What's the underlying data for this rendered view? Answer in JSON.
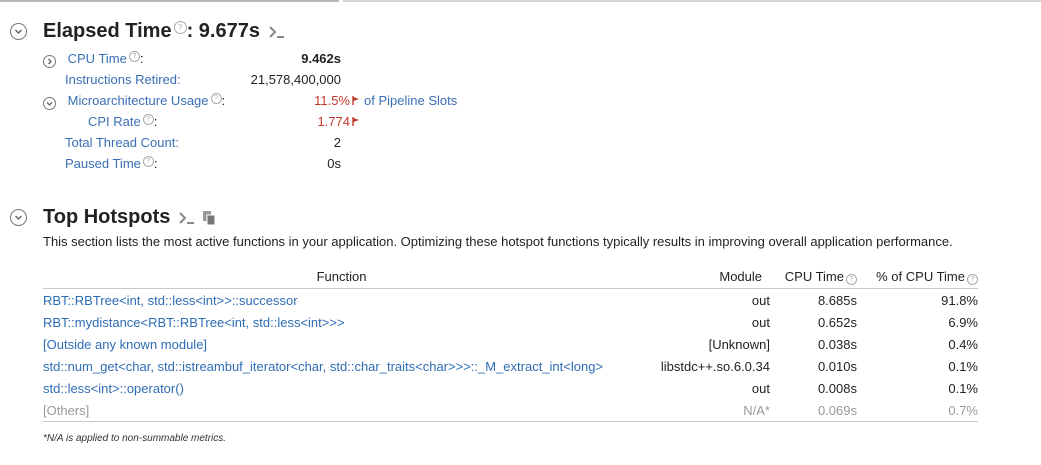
{
  "elapsed": {
    "title": "Elapsed Time",
    "colon_value": ": 9.677s",
    "metrics": [
      {
        "label": "CPU Time",
        "value": "9.462s",
        "bold": true
      },
      {
        "label": "Instructions Retired:",
        "value": "21,578,400,000"
      },
      {
        "label": "Microarchitecture Usage",
        "value": "11.5%",
        "suffix": "of Pipeline Slots"
      },
      {
        "label": "CPI Rate",
        "value": "1.774"
      },
      {
        "label": "Total Thread Count:",
        "value": "2"
      },
      {
        "label": "Paused Time",
        "value": "0s"
      }
    ]
  },
  "hotspots": {
    "title": "Top Hotspots",
    "description": "This section lists the most active functions in your application. Optimizing these hotspot functions typically results in improving overall application performance.",
    "columns": {
      "function": "Function",
      "module": "Module",
      "cpu_time": "CPU Time",
      "pct": "% of CPU Time"
    },
    "rows": [
      {
        "function": "RBT::RBTree<int, std::less<int>>::successor",
        "module": "out",
        "cpu_time": "8.685s",
        "pct": "91.8%"
      },
      {
        "function": "RBT::mydistance<RBT::RBTree<int, std::less<int>>>",
        "module": "out",
        "cpu_time": "0.652s",
        "pct": "6.9%"
      },
      {
        "function": "[Outside any known module]",
        "module": "[Unknown]",
        "cpu_time": "0.038s",
        "pct": "0.4%"
      },
      {
        "function": "std::num_get<char, std::istreambuf_iterator<char, std::char_traits<char>>>::_M_extract_int<long>",
        "module": "libstdc++.so.6.0.34",
        "cpu_time": "0.010s",
        "pct": "0.1%"
      },
      {
        "function": "std::less<int>::operator()",
        "module": "out",
        "cpu_time": "0.008s",
        "pct": "0.1%"
      },
      {
        "function": "[Others]",
        "module": "N/A*",
        "cpu_time": "0.069s",
        "pct": "0.7%"
      }
    ],
    "footnote": "*N/A is applied to non-summable metrics."
  },
  "colors": {
    "link": "#3a6fb5",
    "warning": "#c0392b",
    "muted": "#999999"
  }
}
